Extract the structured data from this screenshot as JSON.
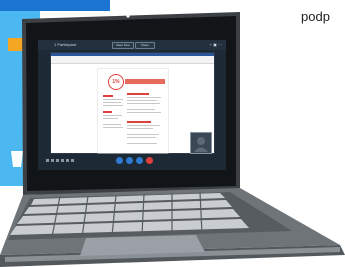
{
  "side_label": "podp",
  "call": {
    "title": "1 Participant",
    "header_buttons": [
      "Meet Now",
      "Share"
    ],
    "header_icons": "+ ▣ ⋯"
  },
  "document": {
    "score_text": "1%"
  },
  "colors": {
    "accent_blue": "#4cb8f2",
    "dark_blue": "#1a74d1",
    "accent_orange": "#f5a623",
    "call_bg": "#1d2935",
    "end_call_red": "#e0403b",
    "laptop_body": "#6f7479"
  },
  "controls": [
    {
      "name": "video-icon",
      "color": "#2e7bd1"
    },
    {
      "name": "microphone-icon",
      "color": "#2e7bd1"
    },
    {
      "name": "share-icon",
      "color": "#2e7bd1"
    },
    {
      "name": "end-call-icon",
      "color": "#e0403b"
    }
  ]
}
